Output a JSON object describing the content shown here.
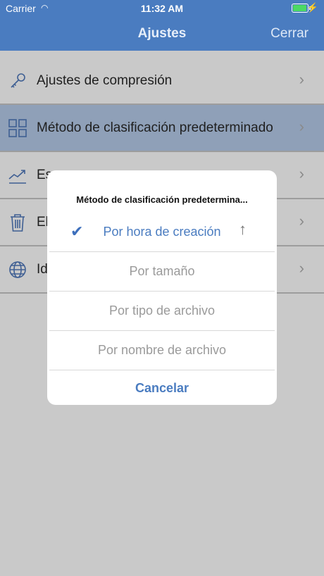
{
  "status": {
    "carrier": "Carrier",
    "time": "11:32 AM",
    "battery_level": 0.95
  },
  "nav": {
    "title": "Ajustes",
    "close": "Cerrar"
  },
  "settings": [
    {
      "label": "Ajustes de compresión",
      "icon": "key-icon"
    },
    {
      "label": "Método de clasificación predeterminado",
      "icon": "grid-icon"
    },
    {
      "label": "Es",
      "icon": "chart-icon"
    },
    {
      "label": "El",
      "icon": "trash-icon"
    },
    {
      "label": "Id",
      "icon": "globe-icon"
    }
  ],
  "dialog": {
    "title": "Método de clasificación predetermina...",
    "options": [
      "Por hora de creación",
      "Por tamaño",
      "Por tipo de archivo",
      "Por nombre de archivo"
    ],
    "cancel": "Cancelar"
  },
  "colors": {
    "nav": "#4a7cc0",
    "accent": "#4a7cc0",
    "overlay": "#c9c9c9"
  }
}
